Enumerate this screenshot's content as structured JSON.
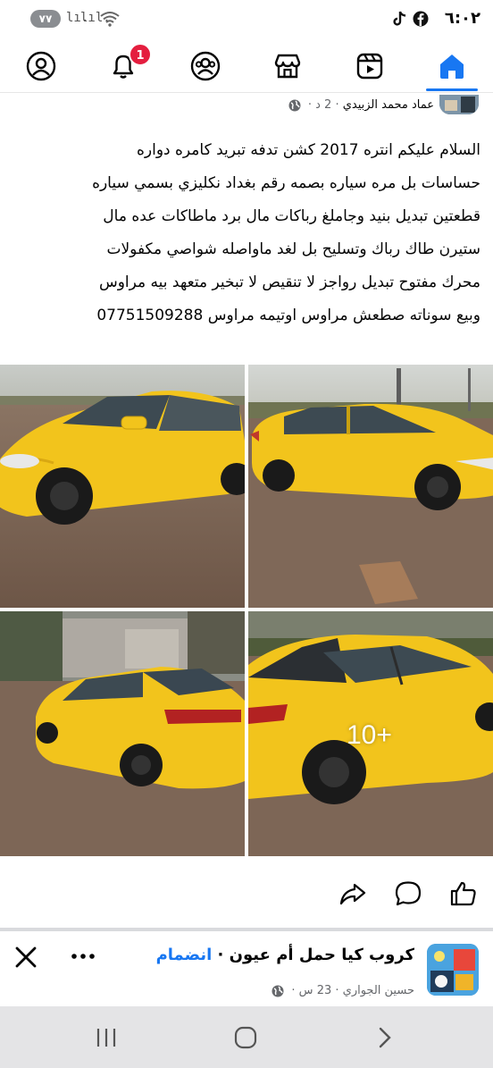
{
  "status_bar": {
    "battery": "٧٧",
    "signal_1": "lı.",
    "signal_2": "lıl.",
    "time": "٦:٠٢"
  },
  "topnav": {
    "items": [
      {
        "name": "profile-icon",
        "active": false
      },
      {
        "name": "bell-icon",
        "active": false,
        "badge": "1"
      },
      {
        "name": "friends-icon",
        "active": false
      },
      {
        "name": "marketplace-icon",
        "active": false
      },
      {
        "name": "video-icon",
        "active": false
      },
      {
        "name": "home-icon",
        "active": true
      }
    ],
    "accent": "#1877f2"
  },
  "post": {
    "author": "عماد محمد الزبيدي",
    "meta": "· 2 د ·",
    "lines": [
      "السلام عليكم انتره 2017 كشن تدفه تبريد كامره دواره",
      "حساسات بل مره سياره بصمه رقم بغداد نكليزي بسمي سياره",
      "قطعتين تبديل بنيد وجاملغ رباكات مال برد ماطاكات عده مال",
      "ستيرن طاك رباك وتسليح بل لغد ماواصله شواصي مكفولات",
      "محرك مفتوح تبديل رواجز  لا تنقيص لا تبخير متعهد بيه مراوس",
      "وبيع سوناته صطعش مراوس اوتيمه مراوس   07751509288"
    ],
    "more_photos": "10+",
    "car_color": "#f2c41c"
  },
  "actions": [
    {
      "name": "share-icon"
    },
    {
      "name": "comment-icon"
    },
    {
      "name": "like-icon"
    }
  ],
  "group_suggestion": {
    "title": "كروب كيا حمل أم عيون",
    "join": "انضمام",
    "member": "حسين الجواري",
    "time": "· 23 س ·"
  }
}
